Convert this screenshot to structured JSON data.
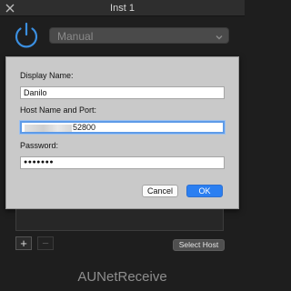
{
  "window": {
    "title": "Inst 1"
  },
  "mode_select": {
    "value": "Manual",
    "icon": "chevron-down-icon"
  },
  "dialog": {
    "display_name_label": "Display Name:",
    "display_name_value": "Danilo",
    "host_label": "Host Name and Port:",
    "host_port_visible": "52800",
    "password_label": "Password:",
    "password_mask": "●●●●●●●",
    "cancel_label": "Cancel",
    "ok_label": "OK"
  },
  "controls": {
    "add_label": "+",
    "remove_label": "−",
    "select_host_label": "Select Host"
  },
  "footer": {
    "app_name": "AUNetReceive"
  },
  "colors": {
    "accent": "#2b7ff1",
    "power": "#3b8fe0",
    "focus_ring": "#5e9be8"
  }
}
